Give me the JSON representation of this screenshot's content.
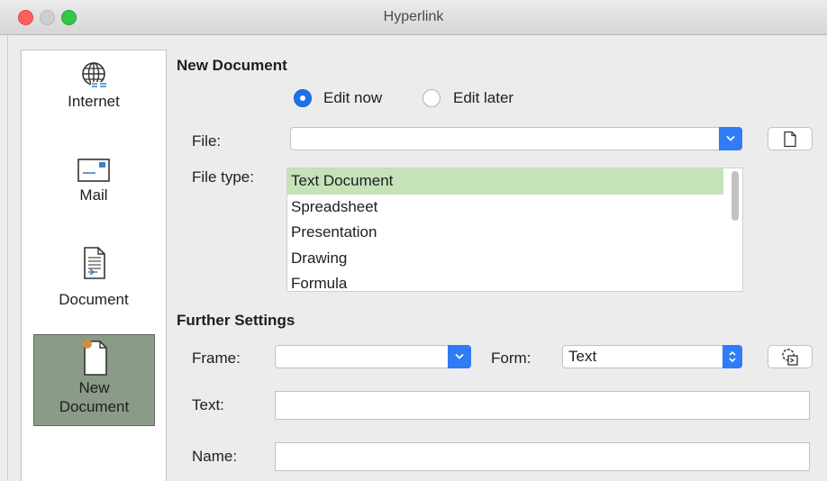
{
  "window": {
    "title": "Hyperlink"
  },
  "sidebar": {
    "items": [
      {
        "label": "Internet",
        "icon": "globe-icon"
      },
      {
        "label": "Mail",
        "icon": "mail-icon"
      },
      {
        "label": "Document",
        "icon": "document-icon"
      },
      {
        "label": "New\nDocument",
        "icon": "new-document-icon",
        "active": true
      }
    ]
  },
  "new_document": {
    "title": "New Document",
    "edit_now_label": "Edit now",
    "edit_later_label": "Edit later",
    "selected": "Edit now",
    "file_label": "File:",
    "file_value": "",
    "file_type_label": "File type:",
    "file_types": [
      "Text Document",
      "Spreadsheet",
      "Presentation",
      "Drawing",
      "Formula"
    ],
    "file_type_selected": "Text Document"
  },
  "further_settings": {
    "title": "Further Settings",
    "frame_label": "Frame:",
    "frame_value": "",
    "form_label": "Form:",
    "form_value": "Text",
    "text_label": "Text:",
    "text_value": "",
    "name_label": "Name:",
    "name_value": ""
  },
  "colors": {
    "accent": "#2f7cf6",
    "selection": "#c5e3b9",
    "active_nav": "#8a9b87"
  }
}
